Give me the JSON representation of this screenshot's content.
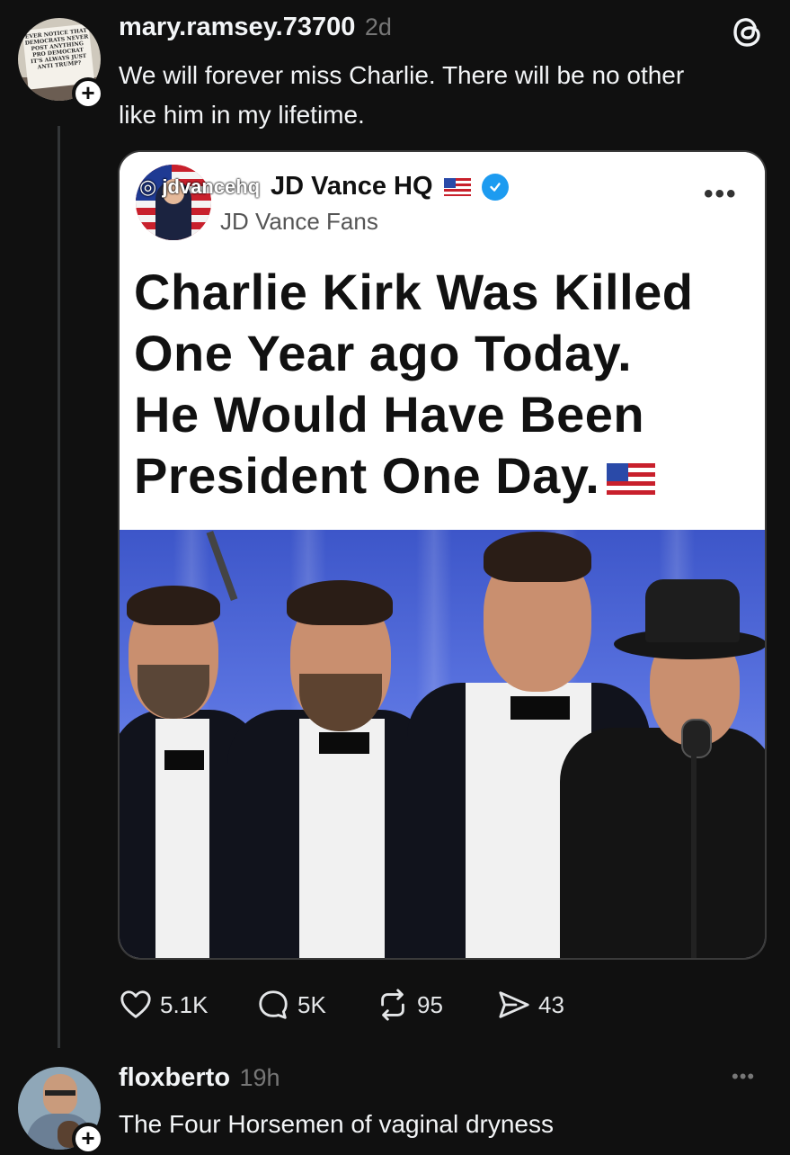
{
  "post1": {
    "username": "mary.ramsey.73700",
    "time": "2d",
    "text_line1": "We will forever miss Charlie.  There will be no other",
    "text_line2": "like him in my lifetime.",
    "avatar_sign_text": "EVER NOTICE THAT\nDEMOCRATS NEVER\nPOST ANYTHING\nPRO DEMOCRAT\nIT'S ALWAYS JUST\nANTI TRUMP?",
    "card": {
      "ig_handle": "jdvancehq",
      "account_name": "JD Vance HQ",
      "account_sub": "JD Vance Fans",
      "headline_line1": "Charlie Kirk Was Killed",
      "headline_line2": "One Year ago Today.",
      "headline_line3": "He Would Have Been",
      "headline_line4": "President One Day.",
      "more_label": "•••"
    },
    "actions": {
      "likes": "5.1K",
      "comments": "5K",
      "reposts": "95",
      "shares": "43"
    }
  },
  "post2": {
    "username": "floxberto",
    "time": "19h",
    "text": "The Four Horsemen of vaginal dryness",
    "more_label": "•••"
  },
  "colors": {
    "background": "#101010",
    "text": "#f3f5f7",
    "muted": "#777777",
    "verified": "#1d9bf0"
  }
}
